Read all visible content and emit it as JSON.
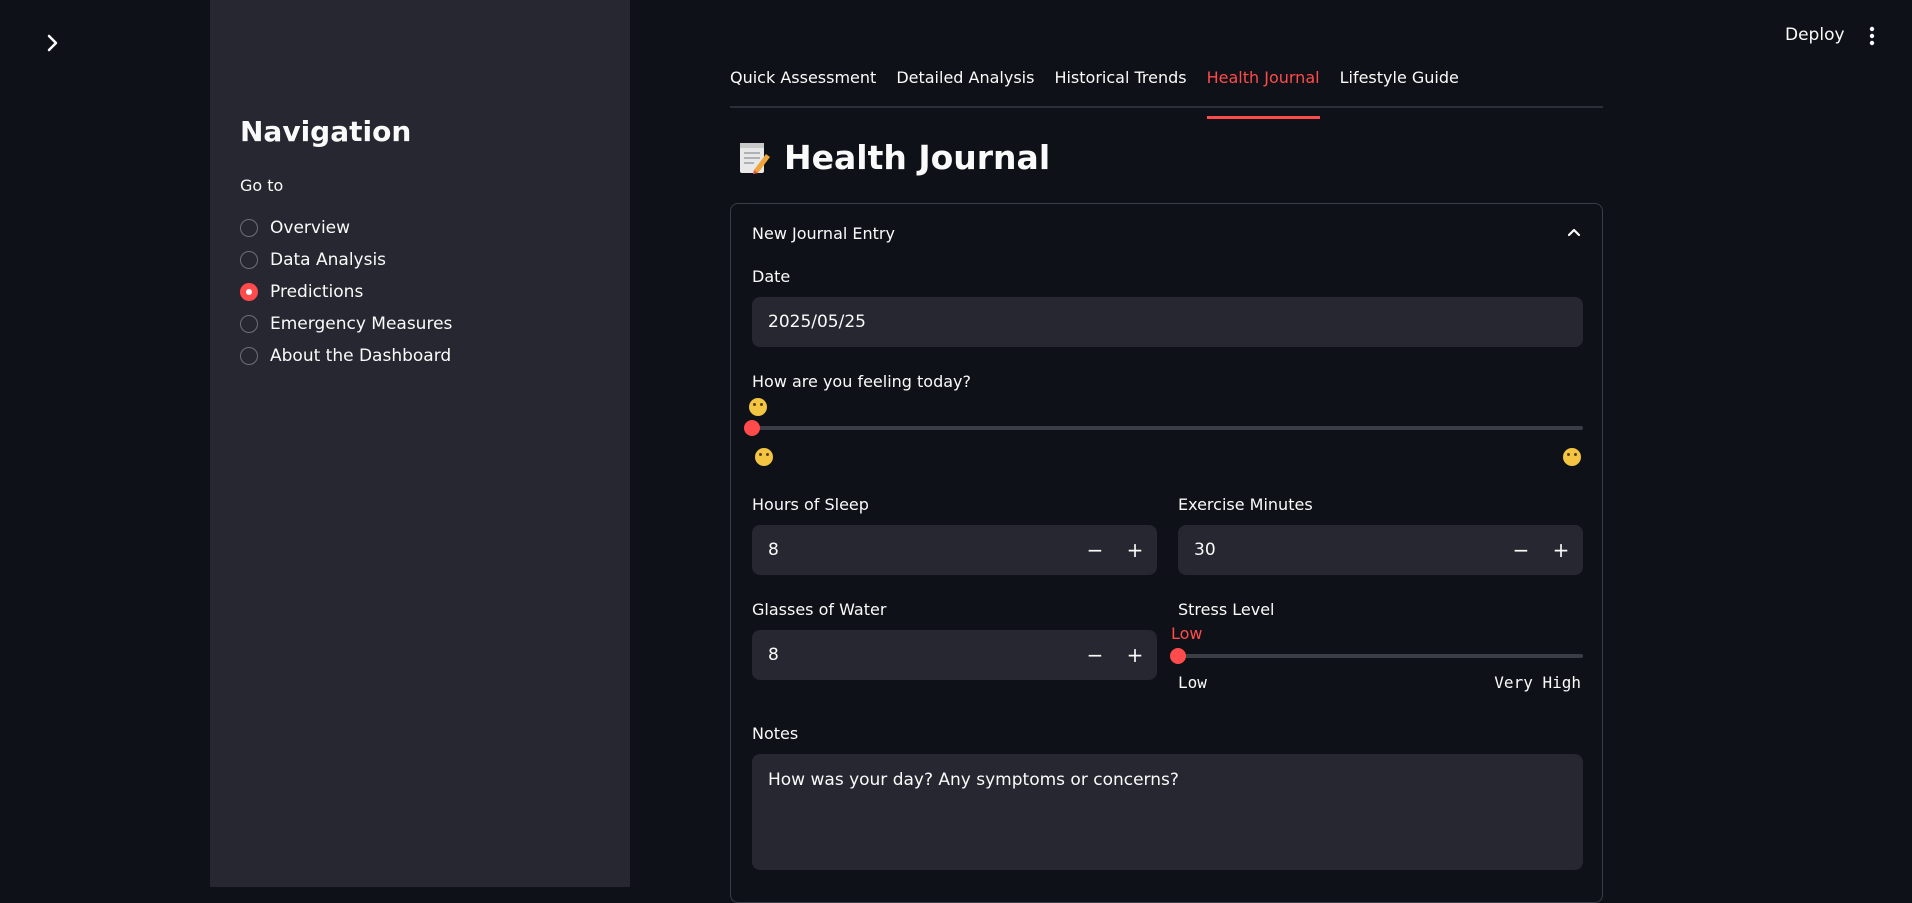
{
  "app": {
    "deploy_label": "Deploy"
  },
  "sidebar": {
    "title": "Navigation",
    "radio_label": "Go to",
    "items": [
      {
        "label": "Overview",
        "selected": false
      },
      {
        "label": "Data Analysis",
        "selected": false
      },
      {
        "label": "Predictions",
        "selected": true
      },
      {
        "label": "Emergency Measures",
        "selected": false
      },
      {
        "label": "About the Dashboard",
        "selected": false
      }
    ]
  },
  "tabs": [
    {
      "label": "Quick Assessment",
      "active": false
    },
    {
      "label": "Detailed Analysis",
      "active": false
    },
    {
      "label": "Historical Trends",
      "active": false
    },
    {
      "label": "Health Journal",
      "active": true
    },
    {
      "label": "Lifestyle Guide",
      "active": false
    }
  ],
  "page": {
    "title": "Health Journal",
    "title_icon": "memo-icon"
  },
  "journal": {
    "expander_title": "New Journal Entry",
    "date_label": "Date",
    "date_value": "2025/05/25",
    "mood_label": "How are you feeling today?",
    "mood_value_fraction": 0.0,
    "mood_min_icon": "flushed-face-icon",
    "mood_max_icon": "smiling-face-icon",
    "sleep_label": "Hours of Sleep",
    "sleep_value": "8",
    "exercise_label": "Exercise Minutes",
    "exercise_value": "30",
    "water_label": "Glasses of Water",
    "water_value": "8",
    "stress_label": "Stress Level",
    "stress_value": "Low",
    "stress_value_fraction": 0.0,
    "stress_min": "Low",
    "stress_max": "Very High",
    "notes_label": "Notes",
    "notes_placeholder": "How was your day? Any symptoms or concerns?"
  },
  "colors": {
    "accent": "#ff4b4b",
    "background": "#0e1117",
    "sidebar": "#262730"
  }
}
